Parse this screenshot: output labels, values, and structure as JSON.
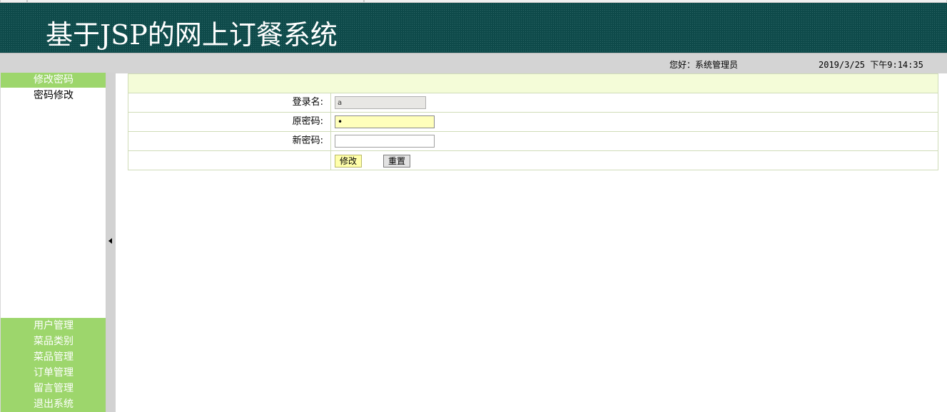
{
  "header": {
    "title": "基于JSP的网上订餐系统"
  },
  "userbar": {
    "greeting": "您好：系统管理员",
    "datetime": "2019/3/25 下午9:14:35"
  },
  "sidebar": {
    "active_menu": "修改密码",
    "sub_items": [
      "密码修改"
    ],
    "menu_items": [
      "用户管理",
      "菜品类别",
      "菜品管理",
      "订单管理",
      "留言管理",
      "退出系统"
    ]
  },
  "form": {
    "login_label": "登录名:",
    "login_value": "a",
    "old_password_label": "原密码:",
    "old_password_value": "•",
    "new_password_label": "新密码:",
    "new_password_value": "",
    "submit_label": "修改",
    "reset_label": "重置"
  },
  "colors": {
    "header_bg": "#0e4a4a",
    "menu_green": "#9dd66c",
    "panel_header": "#f4fcd8",
    "active_input": "#ffffbb"
  }
}
